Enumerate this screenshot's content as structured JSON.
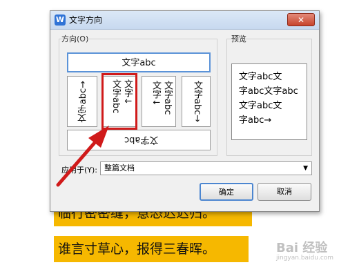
{
  "document": {
    "line1": "临行密密缝，意恐迟迟归。",
    "line2": "谁言寸草心，报得三春晖。"
  },
  "watermark": {
    "text": "Bai 经验",
    "sub": "jingyan.baidu.com"
  },
  "dialog": {
    "title": "文字方向",
    "close": "✕",
    "app_icon": "W",
    "direction_group_label": "方向(O)",
    "preview_label": "预览",
    "options": {
      "horizontal": "文字abc",
      "v1": "文字abc→",
      "v2_col1": "文字abc",
      "v2_col2": "文字↓",
      "v3_col1": "文字↓",
      "v3_col2": "文字abc",
      "v4": "文字abc→",
      "bottom": "文字abc"
    },
    "preview_lines": [
      "文字abc文",
      "字abc文字abc",
      "文字abc文",
      "字abc→"
    ],
    "apply_label": "应用于(Y):",
    "apply_value": "整篇文档",
    "ok": "确定",
    "cancel": "取消"
  },
  "colors": {
    "highlight": "#f6b800",
    "annotation": "#d01a1a"
  }
}
